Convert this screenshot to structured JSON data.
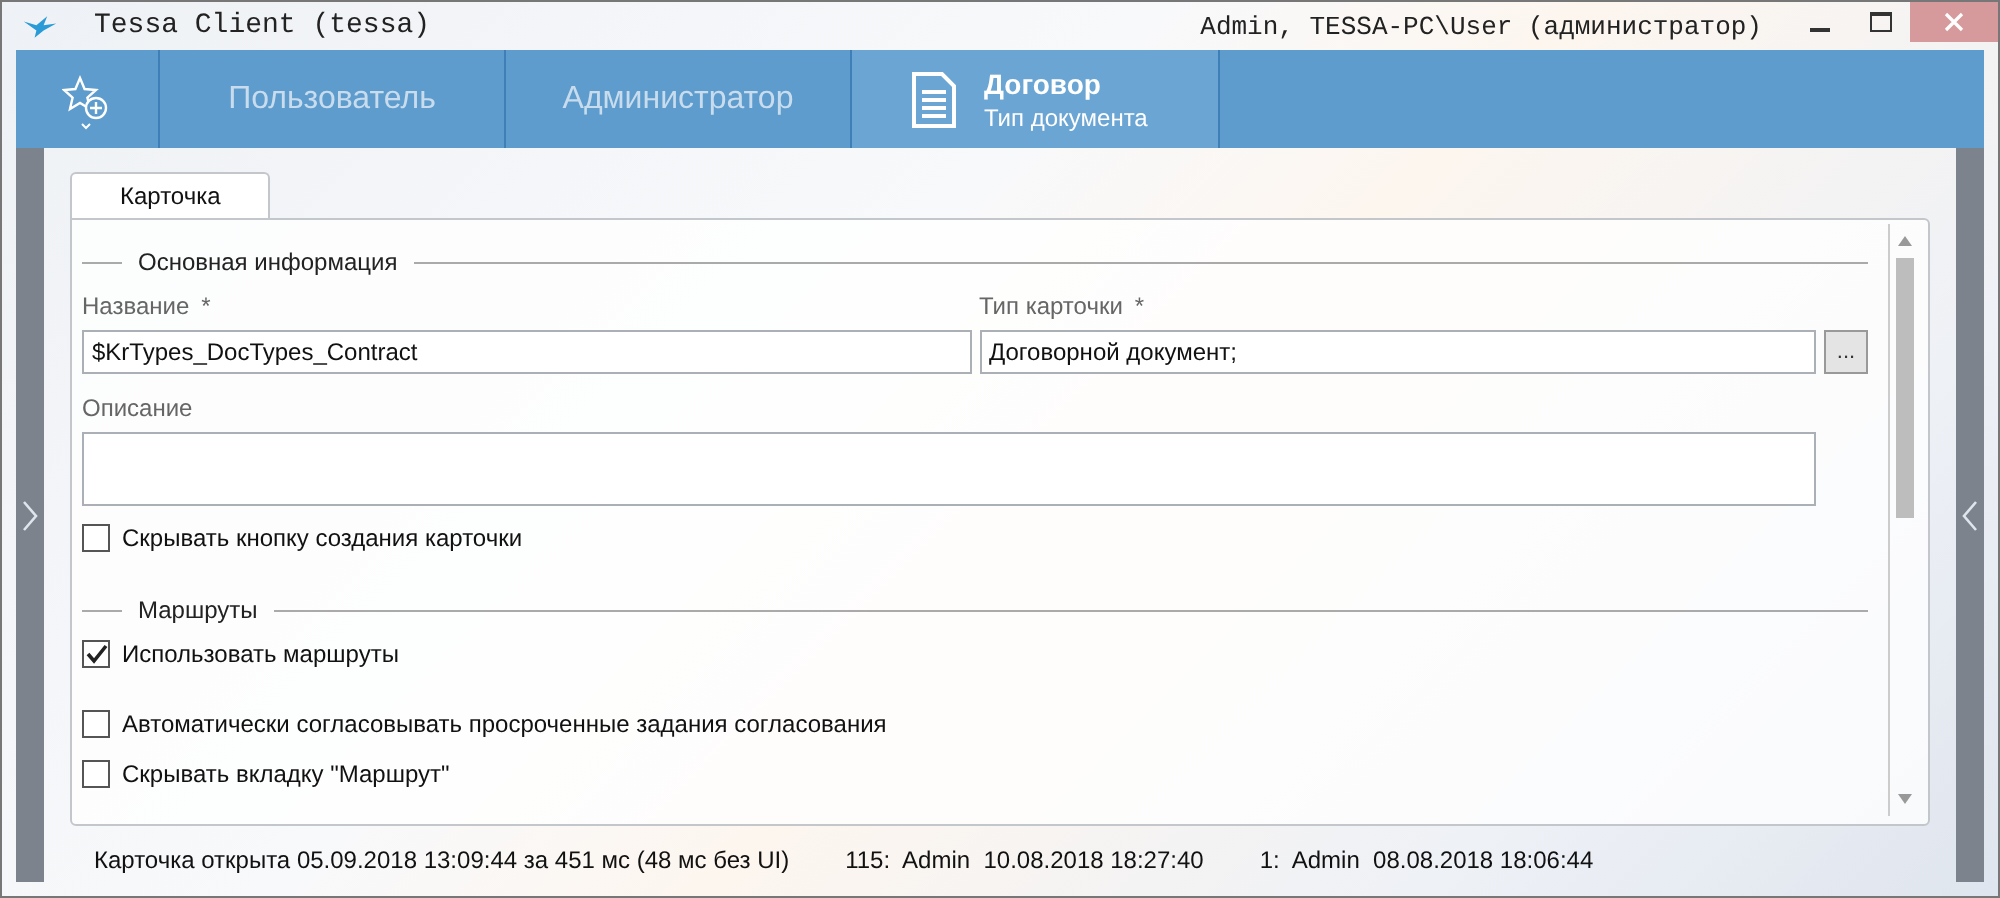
{
  "window": {
    "title": "Tessa Client (tessa)",
    "user": "Admin, TESSA-PC\\User (администратор)"
  },
  "nav": [
    {
      "label": "Пользователь",
      "selected": false
    },
    {
      "label": "Администратор",
      "selected": false
    },
    {
      "label": "Договор",
      "subtitle": "Тип документа",
      "selected": true
    }
  ],
  "tabs": [
    {
      "label": "Карточка",
      "selected": true
    }
  ],
  "sections": [
    {
      "title": "Основная информация",
      "fields": [
        {
          "kind": "text",
          "label": "Название",
          "required_mark": "*",
          "value": "$KrTypes_DocTypes_Contract"
        },
        {
          "kind": "lookup",
          "label": "Тип карточки",
          "required_mark": "*",
          "value": "Договорной документ;",
          "button": "..."
        },
        {
          "kind": "textarea",
          "label": "Описание"
        }
      ],
      "checkboxes": [
        {
          "label": "Скрывать кнопку создания карточки",
          "checked": false
        }
      ]
    },
    {
      "title": "Маршруты",
      "checkboxes": [
        {
          "label": "Использовать маршруты",
          "checked": true
        },
        {
          "label": "Автоматически согласовывать просроченные задания согласования",
          "checked": false
        },
        {
          "label": "Скрывать вкладку \"Маршрут\"",
          "checked": false
        }
      ]
    }
  ],
  "status_bar": [
    "Карточка открыта 05.09.2018 13:09:44 за 451 мс (48 мс без UI)",
    "115:  Admin  10.08.2018 18:27:40",
    "1:  Admin  08.08.2018 18:06:44"
  ]
}
